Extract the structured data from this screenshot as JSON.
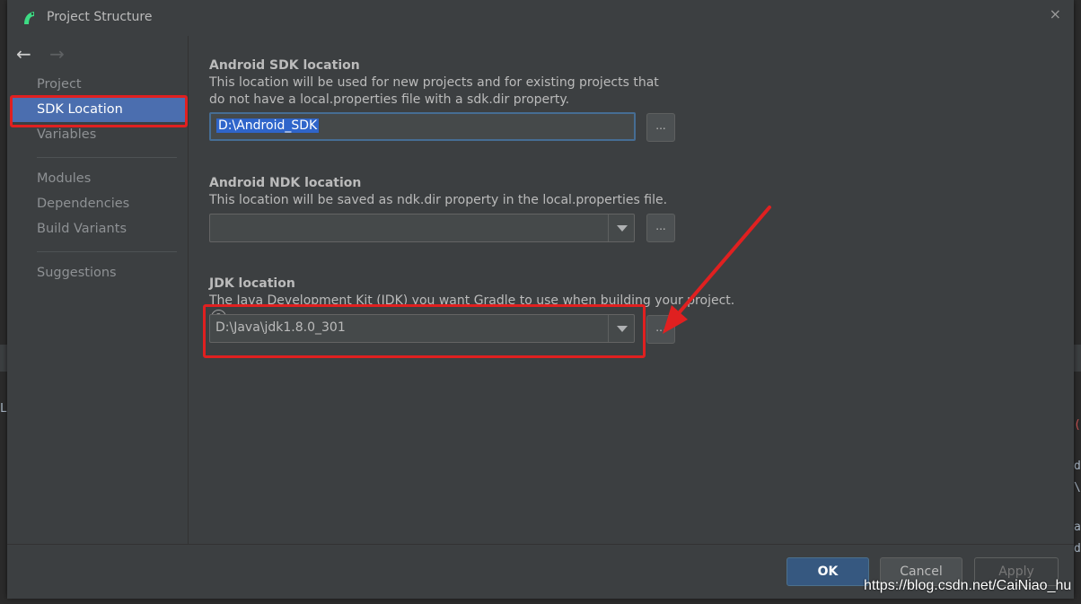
{
  "dialog": {
    "title": "Project Structure",
    "close_label": "×"
  },
  "nav": {
    "back": "←",
    "forward": "→"
  },
  "sidebar": {
    "items": [
      {
        "label": "Project"
      },
      {
        "label": "SDK Location"
      },
      {
        "label": "Variables"
      },
      {
        "label": "Modules"
      },
      {
        "label": "Dependencies"
      },
      {
        "label": "Build Variants"
      },
      {
        "label": "Suggestions"
      }
    ],
    "selected": "SDK Location"
  },
  "sdk": {
    "title": "Android SDK location",
    "description": "This location will be used for new projects and for existing projects that do not have a local.properties file with a sdk.dir property.",
    "value": "D:\\Android_SDK",
    "browse_label": "..."
  },
  "ndk": {
    "title": "Android NDK location",
    "description": "This location will be saved as ndk.dir property in the local.properties file.",
    "value": "",
    "browse_label": "..."
  },
  "jdk": {
    "title": "JDK location",
    "description": "The Java Development Kit (JDK) you want Gradle to use when building your project.",
    "help": "?",
    "value": "D:\\Java\\jdk1.8.0_301",
    "browse_label": "..."
  },
  "footer": {
    "ok": "OK",
    "cancel": "Cancel",
    "apply": "Apply"
  },
  "watermark": "https://blog.csdn.net/CaiNiao_hu",
  "colors": {
    "selection": "#4b6eaf",
    "highlight": "#e02020",
    "ok_button": "#365880"
  },
  "background_editor": {
    "left_char": "L",
    "right_chars": [
      "(",
      "d",
      "\\",
      "a",
      "d"
    ]
  }
}
